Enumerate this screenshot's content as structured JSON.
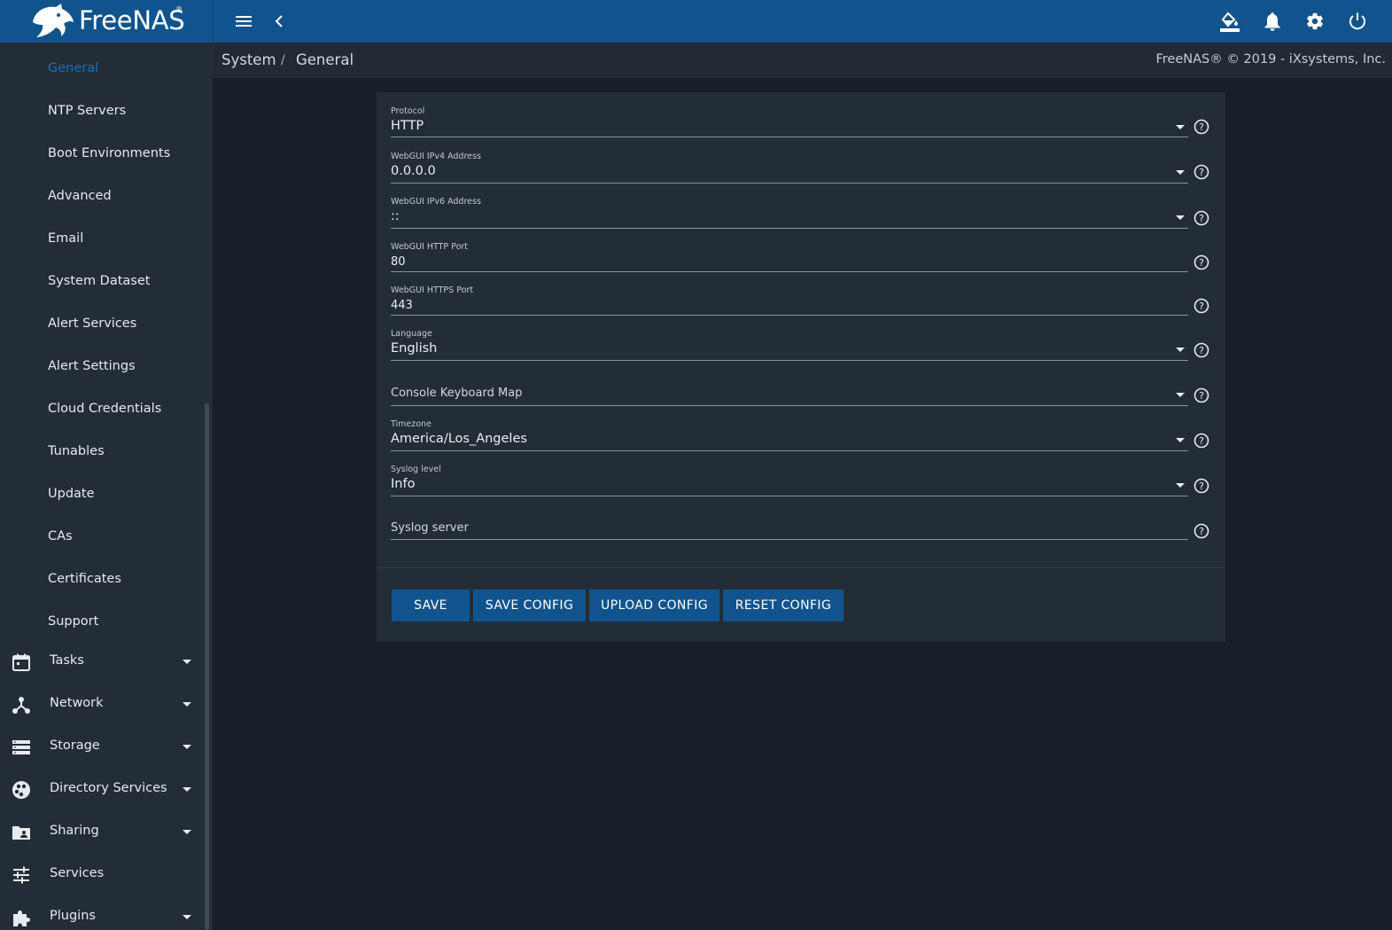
{
  "app": {
    "logo_text": "FreeNAS",
    "logo_reg": "®"
  },
  "topbar": {
    "icons": [
      "menu-icon",
      "chevron-left-icon",
      "paint-bucket-icon",
      "bell-icon",
      "gear-icon",
      "power-icon"
    ]
  },
  "breadcrumb": {
    "parent": "System",
    "separator": "/",
    "current": "General",
    "copyright": "FreeNAS® © 2019 - iXsystems, Inc."
  },
  "sidebar": {
    "sub_items": [
      {
        "label": "General",
        "active": true
      },
      {
        "label": "NTP Servers"
      },
      {
        "label": "Boot Environments"
      },
      {
        "label": "Advanced"
      },
      {
        "label": "Email"
      },
      {
        "label": "System Dataset"
      },
      {
        "label": "Alert Services"
      },
      {
        "label": "Alert Settings"
      },
      {
        "label": "Cloud Credentials"
      },
      {
        "label": "Tunables"
      },
      {
        "label": "Update"
      },
      {
        "label": "CAs"
      },
      {
        "label": "Certificates"
      },
      {
        "label": "Support"
      }
    ],
    "main_items": [
      {
        "label": "Tasks",
        "icon": "calendar-icon",
        "expandable": true
      },
      {
        "label": "Network",
        "icon": "network-icon",
        "expandable": true
      },
      {
        "label": "Storage",
        "icon": "storage-icon",
        "expandable": true
      },
      {
        "label": "Directory Services",
        "icon": "directory-services-icon",
        "expandable": true
      },
      {
        "label": "Sharing",
        "icon": "sharing-folder-icon",
        "expandable": true
      },
      {
        "label": "Services",
        "icon": "services-sliders-icon",
        "expandable": false
      },
      {
        "label": "Plugins",
        "icon": "puzzle-icon",
        "expandable": true
      }
    ]
  },
  "form": {
    "fields": [
      {
        "label": "Protocol",
        "value": "HTTP",
        "type": "select"
      },
      {
        "label": "WebGUI IPv4 Address",
        "value": "0.0.0.0",
        "type": "select"
      },
      {
        "label": "WebGUI IPv6 Address",
        "value": "::",
        "type": "select"
      },
      {
        "label": "WebGUI HTTP Port",
        "value": "80",
        "type": "input"
      },
      {
        "label": "WebGUI HTTPS Port",
        "value": "443",
        "type": "input"
      },
      {
        "label": "Language",
        "value": "English",
        "type": "select"
      },
      {
        "label": "",
        "placeholder": "Console Keyboard Map",
        "value": "",
        "type": "select"
      },
      {
        "label": "Timezone",
        "value": "America/Los_Angeles",
        "type": "select"
      },
      {
        "label": "Syslog level",
        "value": "Info",
        "type": "select"
      },
      {
        "label": "",
        "placeholder": "Syslog server",
        "value": "",
        "type": "input"
      }
    ],
    "buttons": {
      "save": "SAVE",
      "save_config": "SAVE CONFIG",
      "upload_config": "UPLOAD CONFIG",
      "reset_config": "RESET CONFIG"
    }
  },
  "colors": {
    "topbar": "#11548d",
    "sidebar": "#232d38",
    "background": "#181f28",
    "active_link": "#1d6fb8",
    "button": "#11548d"
  }
}
